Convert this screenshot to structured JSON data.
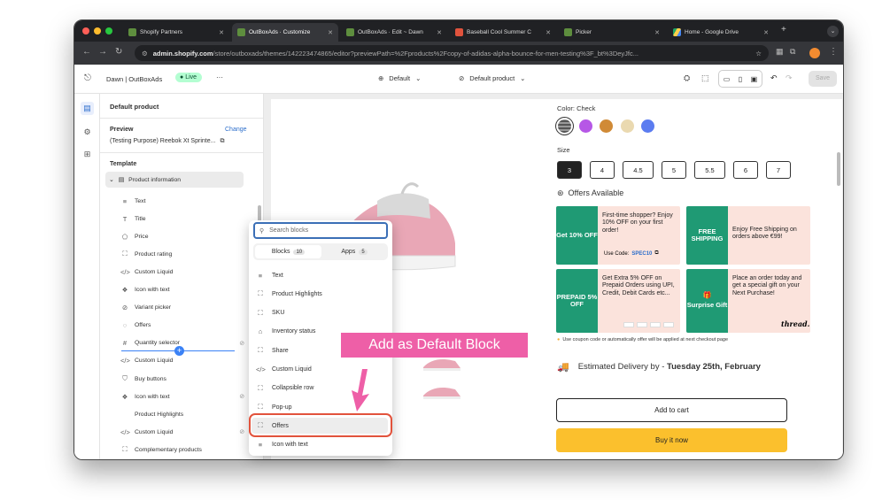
{
  "browser": {
    "tabs": [
      {
        "title": "Shopify Partners"
      },
      {
        "title": "OutBoxAds · Customize"
      },
      {
        "title": "OutBoxAds · Edit ~ Dawn"
      },
      {
        "title": "Baseball Cool Summer C"
      },
      {
        "title": "Picker"
      },
      {
        "title": "Home - Google Drive"
      }
    ],
    "url_host": "admin.shopify.com",
    "url_path": "/store/outboxads/themes/142223474865/editor?previewPath=%2Fproducts%2Fcopy-of-adidas-alpha-bounce-for-men-testing%3F_bt%3DeyJfc..."
  },
  "topbar": {
    "store": "Dawn | OutBoxAds",
    "live": "Live",
    "more": "···",
    "theme_select": "Default",
    "template_select": "Default product",
    "save": "Save"
  },
  "sidebar": {
    "heading": "Default product",
    "preview_label": "Preview",
    "change": "Change",
    "preview_product": "(Testing Purpose) Reebok Xt Sprinte...",
    "template_label": "Template",
    "section": "Product information",
    "items": [
      {
        "label": "Text",
        "icon": "≡"
      },
      {
        "label": "Title",
        "icon": "T"
      },
      {
        "label": "Price",
        "icon": "⬠"
      },
      {
        "label": "Product rating",
        "icon": "⛶"
      },
      {
        "label": "Custom Liquid",
        "icon": "</>"
      },
      {
        "label": "Icon with text",
        "icon": "❖"
      },
      {
        "label": "Variant picker",
        "icon": "⊘"
      },
      {
        "label": "Offers",
        "icon": "◌"
      },
      {
        "label": "Quantity selector",
        "icon": "#"
      },
      {
        "label": "Custom Liquid",
        "icon": "</>"
      },
      {
        "label": "Buy buttons",
        "icon": "⛉"
      },
      {
        "label": "Icon with text",
        "icon": "❖"
      },
      {
        "label": "Product Highlights",
        "icon": ""
      },
      {
        "label": "Custom Liquid",
        "icon": "</>"
      },
      {
        "label": "Complementary products",
        "icon": "⛶"
      }
    ]
  },
  "popup": {
    "search_placeholder": "Search blocks",
    "tab_blocks": "Blocks",
    "tab_blocks_count": "10",
    "tab_apps": "Apps",
    "tab_apps_count": "5",
    "items": [
      {
        "label": "Text",
        "icon": "≡"
      },
      {
        "label": "Product Highlights",
        "icon": "⛶"
      },
      {
        "label": "SKU",
        "icon": "⛶"
      },
      {
        "label": "Inventory status",
        "icon": "⌂"
      },
      {
        "label": "Share",
        "icon": "⛶"
      },
      {
        "label": "Custom Liquid",
        "icon": "</>"
      },
      {
        "label": "Collapsible row",
        "icon": "⛶"
      },
      {
        "label": "Pop-up",
        "icon": "⛶"
      },
      {
        "label": "Offers",
        "icon": "⛶"
      },
      {
        "label": "Icon with text",
        "icon": "≡"
      }
    ]
  },
  "annotation": {
    "label": "Add as Default Block"
  },
  "product": {
    "color_label": "Color: Check",
    "swatches": [
      "#7a7a7a",
      "#b657e6",
      "#d08a36",
      "#ead9b0",
      "#5b7cf0"
    ],
    "size_label": "Size",
    "sizes": [
      "3",
      "4",
      "4.5",
      "5",
      "5.5",
      "6",
      "7"
    ],
    "offers_title": "Offers Available",
    "offers": [
      {
        "tag": "Get 10% OFF",
        "text": "First-time shopper? Enjoy 10% OFF on your first order!",
        "code_label": "Use Code:",
        "code": "SPEC10"
      },
      {
        "tag": "FREE SHIPPING",
        "text": "Enjoy Free Shipping on orders above €99!"
      },
      {
        "tag": "PREPAID 5% OFF",
        "text": "Get Extra 5% OFF on Prepaid Orders using UPI, Credit, Debit Cards etc..."
      },
      {
        "tag": "Surprise Gift",
        "text": "Place an order today and get a special gift on your Next Purchase!",
        "brand": "thread."
      }
    ],
    "coupon_note": "Use coupon code or automatically offer will be applied at next checkout page",
    "delivery_label": "Estimated Delivery by - ",
    "delivery_date": "Tuesday 25th, February",
    "add_to_cart": "Add to cart",
    "buy_now": "Buy it now"
  },
  "colors": {
    "accent_teal": "#1f9a74",
    "offer_bg": "#fbe3dc",
    "buy_now": "#fbc02d",
    "annotation": "#ee5fa7",
    "live_green": "#b4fed2"
  }
}
